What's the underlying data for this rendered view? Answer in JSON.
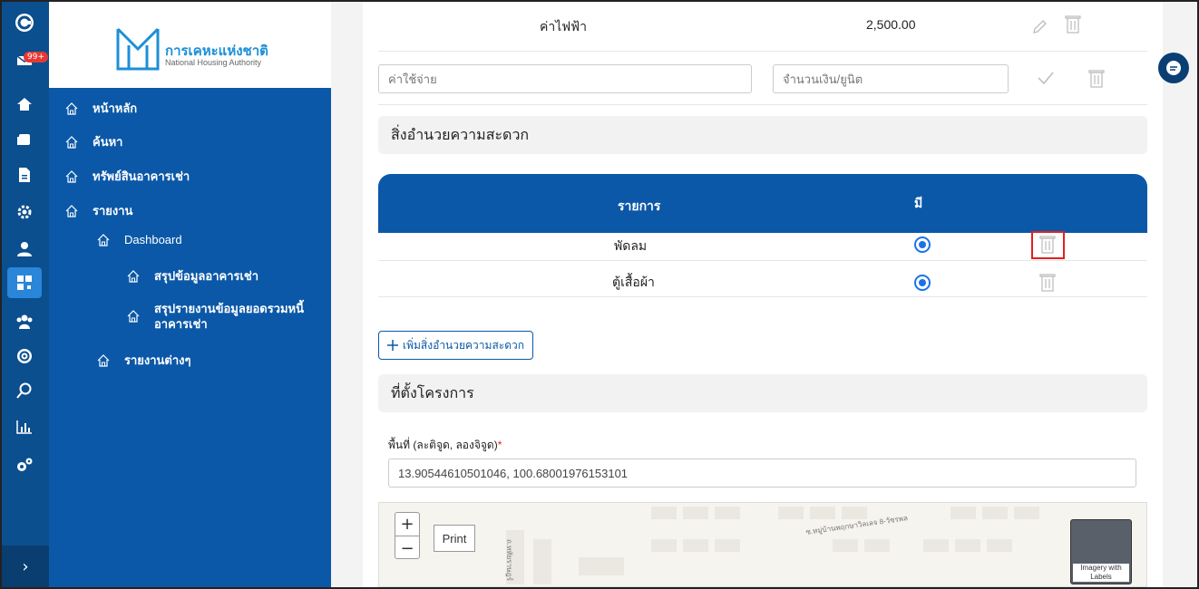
{
  "rail": {
    "badge": "99+",
    "icons": [
      "app-logo-icon",
      "notification-icon",
      "home-icon",
      "card-icon",
      "document-icon",
      "settings-icon",
      "user-icon",
      "dashboard-icon",
      "users-icon",
      "gear-badge-icon",
      "search-icon",
      "chart-icon",
      "cogs-icon"
    ],
    "expand": "›"
  },
  "sidebar": {
    "logo_th": "การเคหะแห่งชาติ",
    "logo_en": "National Housing Authority",
    "items": [
      {
        "label": "หน้าหลัก"
      },
      {
        "label": "ค้นหา"
      },
      {
        "label": "ทรัพย์สินอาคารเช่า"
      },
      {
        "label": "รายงาน"
      },
      {
        "label": "Dashboard"
      },
      {
        "label": "สรุปข้อมูลอาคารเช่า"
      },
      {
        "label": "สรุปรายงานข้อมูลยอดรวมหนี้"
      },
      {
        "label": "อาคารเช่า"
      },
      {
        "label": "รายงานต่างๆ"
      }
    ]
  },
  "expense": {
    "row_name": "ค่าไฟฟ้า",
    "row_amount": "2,500.00",
    "name_placeholder": "ค่าใช้จ่าย",
    "amount_placeholder": "จำนวนเงิน/ยูนิต"
  },
  "facilities": {
    "title": "สิ่งอำนวยความสะดวก",
    "col_item": "รายการ",
    "col_has": "มี",
    "rows": [
      {
        "name": "พัดลม",
        "has": true
      },
      {
        "name": "ตู้เสื้อผ้า",
        "has": true
      }
    ],
    "add_button": "เพิ่มสิ่งอำนวยความสะดวก"
  },
  "location": {
    "title": "ที่ตั้งโครงการ",
    "field_label": "พื้นที่ (ละติจูด, ลองจิจูด)",
    "required_mark": "*",
    "coords": "13.90544610501046, 100.68001976153101",
    "map": {
      "zoom_in": "+",
      "zoom_out": "−",
      "print": "Print",
      "basemap_label": "Imagery with Labels",
      "road_labels": [
        "ซ.หมู่บ้านพฤกษาวิลเลจ 8-วัชรพล",
        "ถ.หทัยราษฎร์"
      ]
    }
  },
  "colors": {
    "primary": "#0b58a8",
    "rail": "#0b4f8f",
    "highlight": "#e02020",
    "radio": "#1a73e8"
  }
}
